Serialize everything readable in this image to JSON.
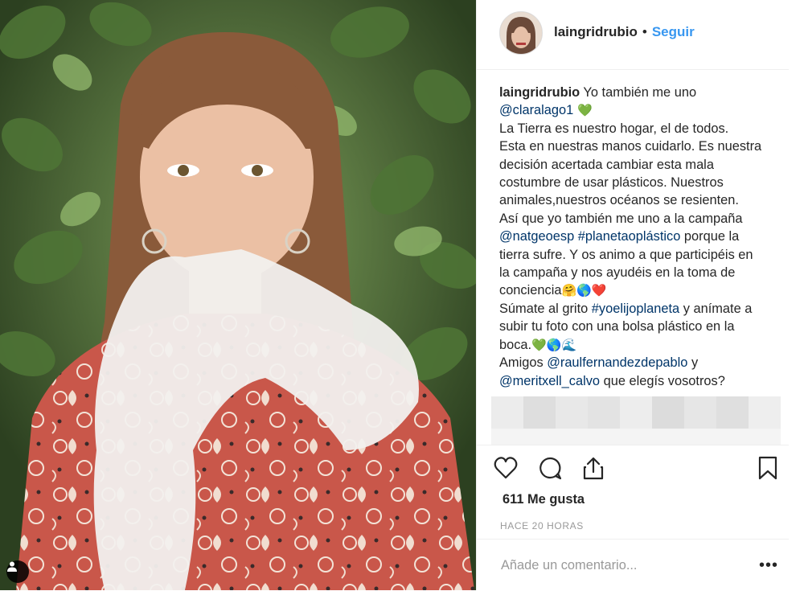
{
  "post": {
    "username": "laingridrubio",
    "separator": "•",
    "follow_label": "Seguir",
    "caption_lines": [
      {
        "user": "laingridrubio",
        "text": " Yo también me uno"
      },
      {
        "mention": "@claralago1",
        "emoji": " 💚"
      },
      {
        "text": "La Tierra es nuestro hogar, el de todos."
      },
      {
        "text": "Esta en nuestras manos cuidarlo. Es nuestra"
      },
      {
        "text": "decisión acertada cambiar esta mala"
      },
      {
        "text": "costumbre de usar plásticos. Nuestros"
      },
      {
        "text": "animales,nuestros océanos se resienten."
      },
      {
        "text": "Así que yo también me uno a la campaña"
      },
      {
        "mention": "@natgeoesp #planetaoplástico",
        "text": " porque la"
      },
      {
        "text": "tierra sufre. Y os animo a que participéis en"
      },
      {
        "text": "la campaña y nos ayudéis en la toma de"
      },
      {
        "text": "conciencia",
        "emoji": "🤗🌎❤️"
      },
      {
        "text": "Súmate al grito ",
        "mention": "#yoelijoplaneta",
        "text2": " y anímate a"
      },
      {
        "text": "subir tu foto con una bolsa plástico en la"
      },
      {
        "text": "boca.",
        "emoji": "💚🌎🌊"
      },
      {
        "text": "Amigos ",
        "mention": "@raulfernandezdepablo",
        "text2": " y"
      },
      {
        "mention": "@meritxell_calvo",
        "text": " que elegís vosotros?"
      }
    ],
    "likes_label": "611 Me gusta",
    "time_label": "HACE 20 HORAS",
    "comment_placeholder": "Añade un comentario...",
    "more_label": "•••"
  },
  "icons": {
    "like": "heart-icon",
    "comment": "comment-bubble-icon",
    "share": "share-upload-icon",
    "save": "bookmark-icon",
    "tagged": "person-tag-icon"
  },
  "colors": {
    "link": "#003569",
    "follow": "#3897f0",
    "text": "#262626",
    "muted": "#999999",
    "border": "#efefef"
  }
}
